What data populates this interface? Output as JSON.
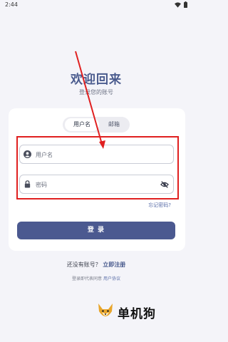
{
  "status_bar": {
    "time": "2:44"
  },
  "header": {
    "title": "欢迎回来",
    "subtitle": "登录您的账号"
  },
  "tabs": [
    {
      "label": "用户名",
      "active": true
    },
    {
      "label": "邮箱",
      "active": false
    }
  ],
  "form": {
    "username_placeholder": "用户名",
    "password_placeholder": "密码",
    "forgot_label": "忘记密码?",
    "login_label": "登 录"
  },
  "footer": {
    "no_account": "还没有账号？",
    "register_link": "立即注册",
    "agree_text": "登录即代表同意",
    "agreement_link": "用户协议"
  },
  "watermark": {
    "text": "单机狗"
  },
  "colors": {
    "accent": "#4b5990",
    "highlight": "#e02020",
    "background": "#f4f4f9"
  }
}
